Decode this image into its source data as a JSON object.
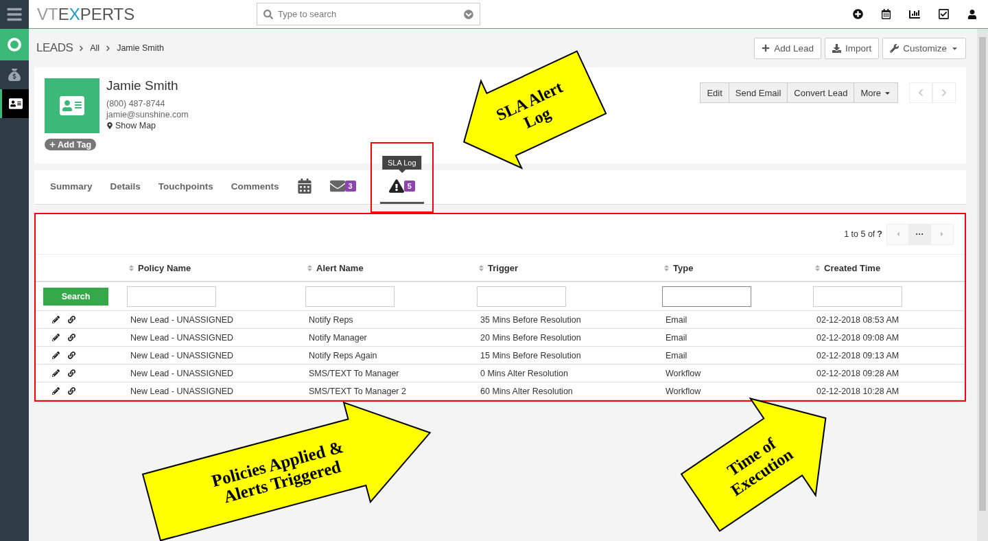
{
  "logo": [
    {
      "text": "VT",
      "color": "#9a9a9a"
    },
    {
      "text": "E",
      "color": "#555555"
    },
    {
      "text": "X",
      "color": "#1a9bc7"
    },
    {
      "text": "PERTS",
      "color": "#555555"
    }
  ],
  "search": {
    "placeholder": "Type to search"
  },
  "sidebar": {
    "items": [
      {
        "kind": "menu",
        "selected": false
      },
      {
        "kind": "ring",
        "selected": false
      },
      {
        "kind": "money",
        "selected": false
      },
      {
        "kind": "card",
        "selected": true
      }
    ]
  },
  "breadcrumb": [
    "LEADS",
    "All",
    "Jamie Smith"
  ],
  "header_buttons": [
    {
      "kind": "plus",
      "label": "Add Lead"
    },
    {
      "kind": "import",
      "label": "Import"
    },
    {
      "kind": "wrench",
      "label": "Customize"
    }
  ],
  "record": {
    "name": "Jamie Smith",
    "phone": "(800) 487-8744",
    "email": "jamie@sunshine.com",
    "map_link": "Show Map",
    "add_tag": "Add Tag"
  },
  "actions": [
    "Edit",
    "Send Email",
    "Convert Lead",
    "More"
  ],
  "tabs": [
    {
      "kind": "text",
      "label": "Summary",
      "selected": false
    },
    {
      "kind": "text",
      "label": "Details",
      "selected": false
    },
    {
      "kind": "text",
      "label": "Touchpoints",
      "selected": false
    },
    {
      "kind": "text",
      "label": "Comments",
      "selected": false
    },
    {
      "kind": "calendar",
      "selected": false
    },
    {
      "kind": "mail",
      "badge": "3",
      "selected": false
    },
    {
      "kind": "alert",
      "badge": "5",
      "tooltip": "SLA Log",
      "selected": true,
      "highlighted": true
    }
  ],
  "table": {
    "highlighted": true,
    "pagination": {
      "range": "1 to 5  of",
      "total": "?",
      "more": "···"
    },
    "search_button": "Search",
    "columns": [
      "Policy Name",
      "Alert Name",
      "Trigger",
      "Type",
      "Created Time"
    ],
    "rows": [
      [
        "New Lead - UNASSIGNED",
        "Notify Reps",
        "35 Mins Before Resolution",
        "Email",
        "02-12-2018 08:53 AM"
      ],
      [
        "New Lead - UNASSIGNED",
        "Notify Manager",
        "20 Mins Before Resolution",
        "Email",
        "02-12-2018 09:08 AM"
      ],
      [
        "New Lead - UNASSIGNED",
        "Notify Reps Again",
        "15 Mins Before Resolution",
        "Email",
        "02-12-2018 09:13 AM"
      ],
      [
        "New Lead - UNASSIGNED",
        "SMS/TEXT To Manager",
        "0 Mins Alter Resolution",
        "Workflow",
        "02-12-2018 09:28 AM"
      ],
      [
        "New Lead - UNASSIGNED",
        "SMS/TEXT To Manager 2",
        "60 Mins Alter Resolution",
        "Workflow",
        "02-12-2018 10:28 AM"
      ]
    ]
  },
  "callouts": [
    {
      "lines": [
        "SLA Alert",
        "Log"
      ]
    },
    {
      "lines": [
        "Policies Applied &",
        "Alerts Triggered"
      ]
    },
    {
      "lines": [
        "Time of",
        "Execution"
      ]
    }
  ]
}
